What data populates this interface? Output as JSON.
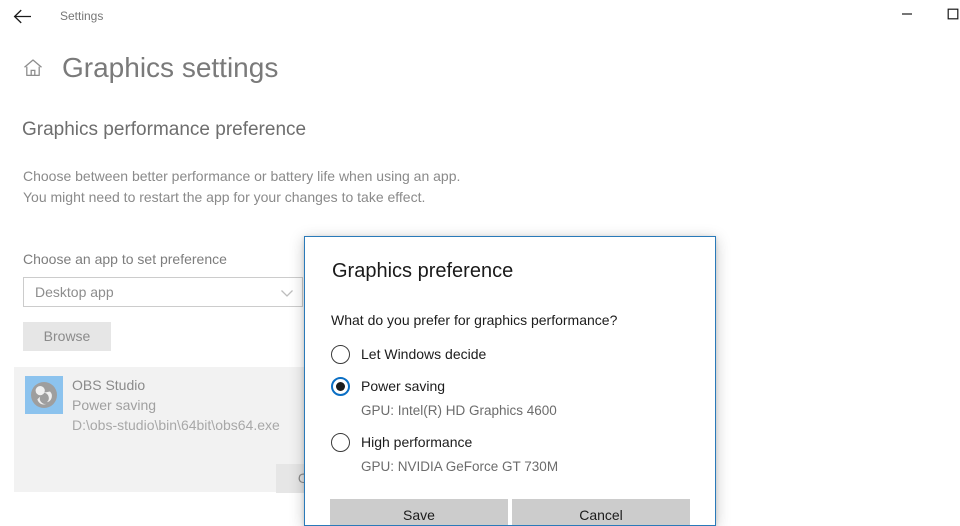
{
  "titlebar": {
    "app_title": "Settings",
    "back_icon": "back-arrow-icon",
    "minimize_label": "—",
    "maximize_label": "□"
  },
  "header": {
    "home_icon": "home-icon",
    "page_title": "Graphics settings"
  },
  "main": {
    "section_title": "Graphics performance preference",
    "section_description": "Choose between better performance or battery life when using an app. You might need to restart the app for your changes to take effect.",
    "choose_label": "Choose an app to set preference",
    "app_type": {
      "selected": "Desktop app",
      "chevron_icon": "chevron-down-icon"
    },
    "browse_label": "Browse",
    "app_entry": {
      "icon": "obs-studio-icon",
      "name": "OBS Studio",
      "preference": "Power saving",
      "path": "D:\\obs-studio\\bin\\64bit\\obs64.exe",
      "options_label": "Options"
    }
  },
  "dialog": {
    "title": "Graphics preference",
    "question": "What do you prefer for graphics performance?",
    "options": [
      {
        "label": "Let Windows decide",
        "selected": false,
        "gpu": ""
      },
      {
        "label": "Power saving",
        "selected": true,
        "gpu": "GPU: Intel(R) HD Graphics 4600"
      },
      {
        "label": "High performance",
        "selected": false,
        "gpu": "GPU: NVIDIA GeForce GT 730M"
      }
    ],
    "save_label": "Save",
    "cancel_label": "Cancel",
    "accent_color": "#0b6fc4",
    "border_color": "#2a7ab9"
  }
}
